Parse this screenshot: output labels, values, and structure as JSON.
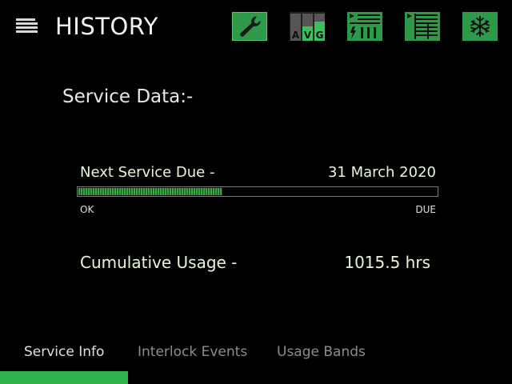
{
  "header": {
    "title": "HISTORY",
    "menu_icon": "hamburger-icon",
    "toolbar": [
      {
        "name": "service-wrench-button",
        "icon": "wrench-icon"
      },
      {
        "name": "average-button",
        "icon": "avg-bars-icon",
        "letters": [
          "A",
          "V",
          "G"
        ]
      },
      {
        "name": "interlock-log-button",
        "icon": "log-bars-icon"
      },
      {
        "name": "usage-log-button",
        "icon": "log-list-icon"
      },
      {
        "name": "refrigeration-button",
        "icon": "snowflake-icon"
      }
    ]
  },
  "service": {
    "title": "Service Data:-",
    "next_service_label": "Next Service Due -",
    "next_service_date": "31 March 2020",
    "progress_fraction": 0.4,
    "progress_min_label": "OK",
    "progress_max_label": "DUE",
    "usage_label": "Cumulative Usage -",
    "usage_value": "1015.5 hrs"
  },
  "tabs": [
    {
      "label": "Service Info",
      "active": true
    },
    {
      "label": "Interlock Events",
      "active": false
    },
    {
      "label": "Usage Bands",
      "active": false
    }
  ],
  "colors": {
    "accent_green": "#2fb34b",
    "progress_green": "#3aa843",
    "background": "#000000",
    "text_light_green": "#e9f5dc"
  }
}
